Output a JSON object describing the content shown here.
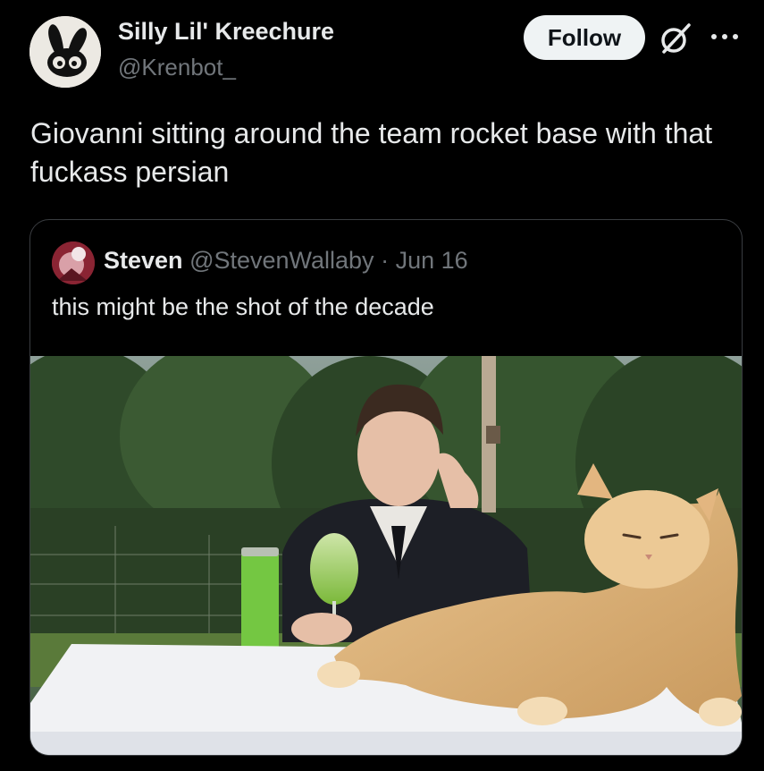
{
  "author": {
    "display_name": "Silly Lil' Kreechure",
    "handle": "@Krenbot_",
    "avatar_icon": "cartoon-bunny-avatar"
  },
  "actions": {
    "follow_label": "Follow",
    "grok_icon": "grok-slash-circle-icon",
    "more_icon": "more-dots-icon"
  },
  "tweet": {
    "text": "Giovanni sitting around the team rocket base with that fuckass persian"
  },
  "quoted_tweet": {
    "display_name": "Steven",
    "handle": "@StevenWallaby",
    "separator": "·",
    "date": "Jun 16",
    "text": "this might be the shot of the decade",
    "media_description_icon": "photo-man-in-suit-with-orange-cat"
  },
  "colors": {
    "background": "#000000",
    "text_primary": "#e7e9ea",
    "text_secondary": "#71767b",
    "follow_button_bg": "#eff3f4",
    "border": "#3a3d41"
  }
}
